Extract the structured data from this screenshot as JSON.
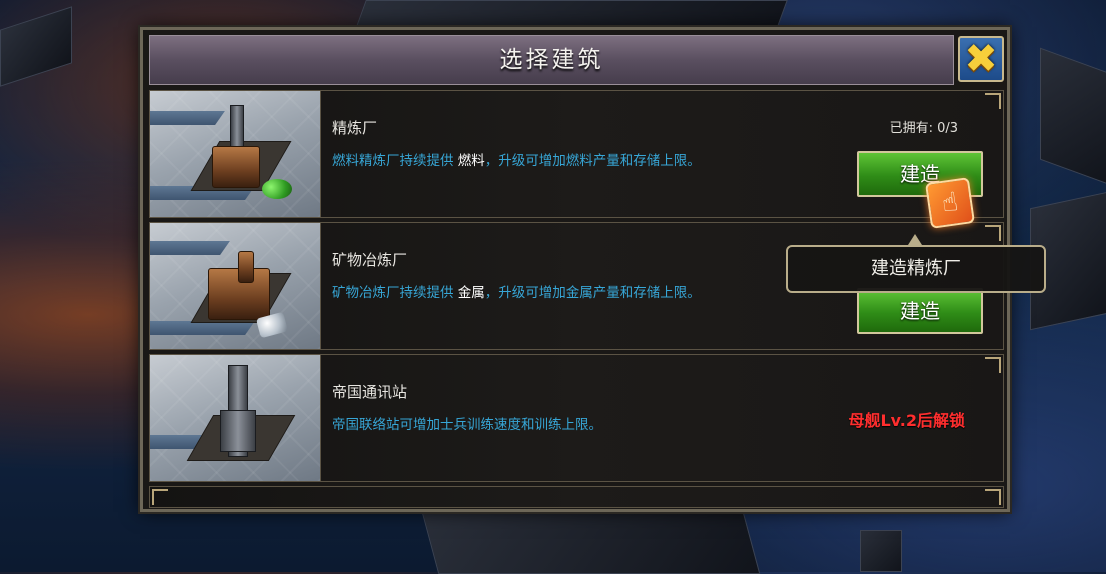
{
  "dialog": {
    "title": "选择建筑",
    "close_glyph": "✖"
  },
  "buildings": [
    {
      "name": "精炼厂",
      "desc_before": "燃料精炼厂持续提供",
      "desc_highlight": "燃料",
      "desc_after": "，升级可增加燃料产量和存储上限。",
      "owned": "已拥有: 0/3",
      "action": "建造"
    },
    {
      "name": "矿物冶炼厂",
      "desc_before": "矿物冶炼厂持续提供",
      "desc_highlight": "金属",
      "desc_after": "，升级可增加金属产量和存储上限。",
      "action": "建造"
    },
    {
      "name": "帝国通讯站",
      "desc": "帝国联络站可增加士兵训练速度和训练上限。",
      "locked_text": "母舰Lv.2后解锁"
    }
  ],
  "tooltip": {
    "text": "建造精炼厂"
  },
  "pointer": {
    "icon": "hand-pointer-icon",
    "glyph": "☝"
  },
  "colors": {
    "desc_blue": "#37a6d6",
    "build_green": "#2f8c17",
    "locked_red": "#ff2e2e",
    "close_yellow": "#f7cf3b"
  }
}
